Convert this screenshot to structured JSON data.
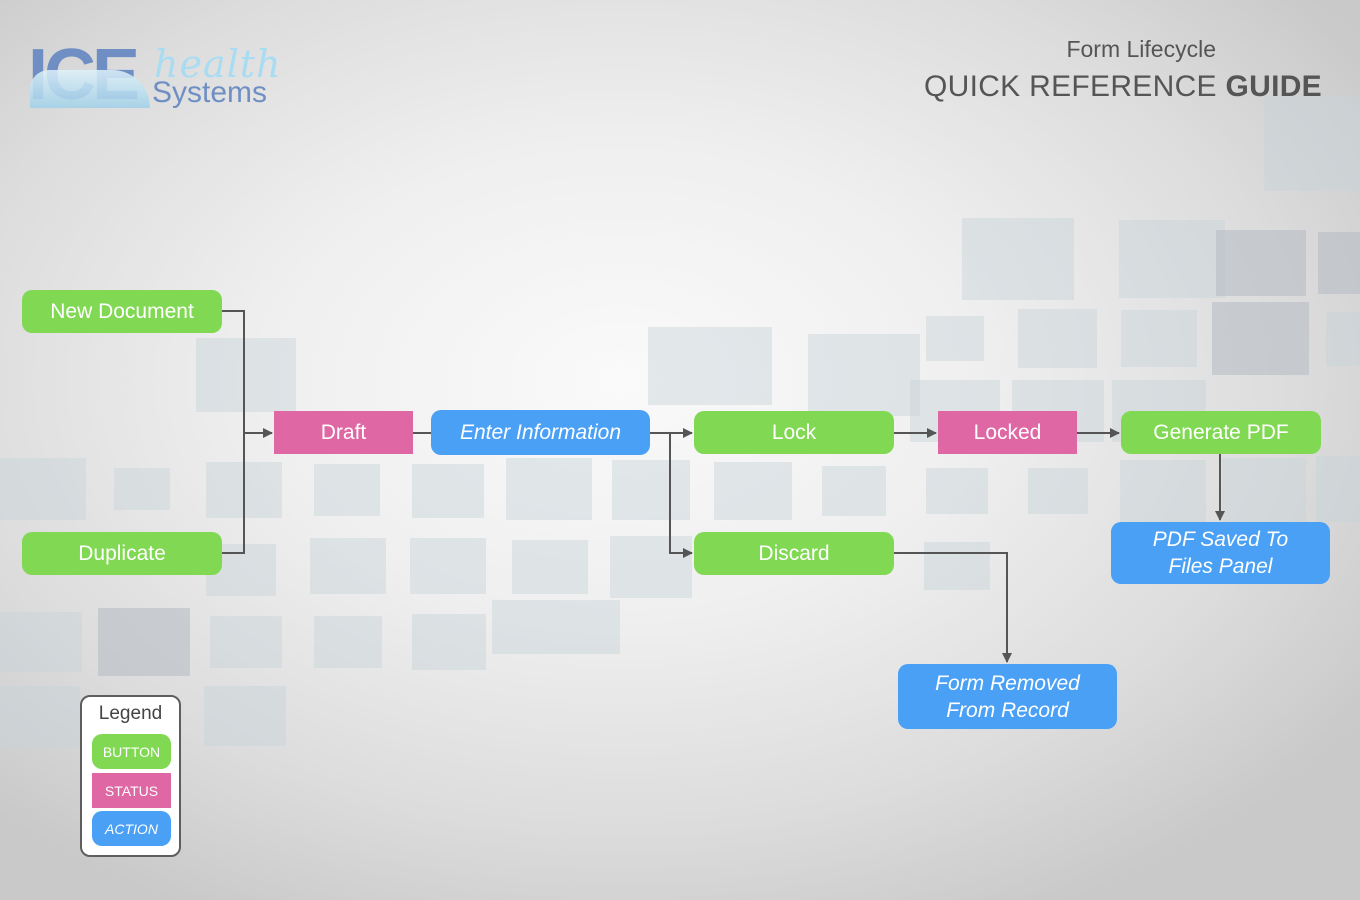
{
  "logo": {
    "primary": "ICE",
    "secondary": "health",
    "tertiary": "Systems"
  },
  "header": {
    "subtitle": "Form Lifecycle",
    "title_regular": "QUICK REFERENCE ",
    "title_bold": "GUIDE"
  },
  "colors": {
    "button": "#80d853",
    "status": "#de67a4",
    "action": "#4aa0f5",
    "connector": "#555555"
  },
  "nodes": {
    "new_document": {
      "label": "New Document",
      "type": "button"
    },
    "duplicate": {
      "label": "Duplicate",
      "type": "button"
    },
    "draft": {
      "label": "Draft",
      "type": "status"
    },
    "enter_information": {
      "label": "Enter Information",
      "type": "action"
    },
    "lock": {
      "label": "Lock",
      "type": "button"
    },
    "discard": {
      "label": "Discard",
      "type": "button"
    },
    "locked": {
      "label": "Locked",
      "type": "status"
    },
    "generate_pdf": {
      "label": "Generate PDF",
      "type": "button"
    },
    "pdf_saved": {
      "label": "PDF Saved To Files Panel",
      "line1": "PDF Saved To",
      "line2": "Files Panel",
      "type": "action"
    },
    "form_removed": {
      "label": "Form Removed From Record",
      "line1": "Form Removed",
      "line2": "From Record",
      "type": "action"
    }
  },
  "edges": [
    [
      "new_document",
      "draft"
    ],
    [
      "duplicate",
      "draft"
    ],
    [
      "draft",
      "enter_information"
    ],
    [
      "enter_information",
      "lock"
    ],
    [
      "enter_information",
      "discard"
    ],
    [
      "lock",
      "locked"
    ],
    [
      "locked",
      "generate_pdf"
    ],
    [
      "generate_pdf",
      "pdf_saved"
    ],
    [
      "discard",
      "form_removed"
    ]
  ],
  "legend": {
    "title": "Legend",
    "items": [
      {
        "label": "BUTTON",
        "type": "button"
      },
      {
        "label": "STATUS",
        "type": "status"
      },
      {
        "label": "ACTION",
        "type": "action"
      }
    ]
  }
}
